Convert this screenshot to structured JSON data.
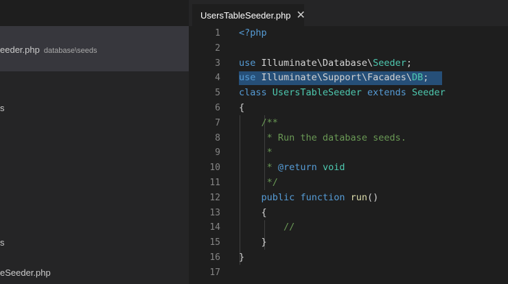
{
  "tab": {
    "title": "UsersTableSeeder.php",
    "close": "✕",
    "icon": "php-file-icon"
  },
  "explorer": {
    "selected_file": "eeder.php",
    "selected_path": "database\\seeds",
    "fragments": [
      "s",
      "s",
      "eSeeder.php"
    ]
  },
  "editor": {
    "line_numbers": [
      "1",
      "2",
      "3",
      "4",
      "5",
      "6",
      "7",
      "8",
      "9",
      "10",
      "11",
      "12",
      "13",
      "14",
      "15",
      "16",
      "17"
    ],
    "lines": {
      "l1": {
        "a": "<?php"
      },
      "l3": {
        "a": "use",
        "b": " Illuminate\\Database\\",
        "c": "Seeder",
        "d": ";"
      },
      "l4": {
        "a": "use",
        "b": " Illuminate\\Support\\Facades\\",
        "c": "DB",
        "d": ";"
      },
      "l5": {
        "a": "class",
        "b": " ",
        "c": "UsersTableSeeder",
        "d": " extends ",
        "e": "Seeder"
      },
      "l6": {
        "a": "{"
      },
      "l7": {
        "a": "/**"
      },
      "l8": {
        "a": " * Run the database seeds."
      },
      "l9": {
        "a": " *"
      },
      "l10": {
        "a": " * ",
        "b": "@return",
        "c": " void"
      },
      "l11": {
        "a": " */"
      },
      "l12": {
        "a": "public",
        "b": " ",
        "c": "function",
        "d": " ",
        "e": "run",
        "f": "()"
      },
      "l13": {
        "a": "{"
      },
      "l14": {
        "a": "//"
      },
      "l15": {
        "a": "}"
      },
      "l16": {
        "a": "}"
      }
    }
  },
  "colors": {
    "keyword": "#569cd6",
    "class": "#4ec9b0",
    "comment": "#6a9955",
    "function": "#dcdcaa",
    "selection": "#264f78"
  }
}
